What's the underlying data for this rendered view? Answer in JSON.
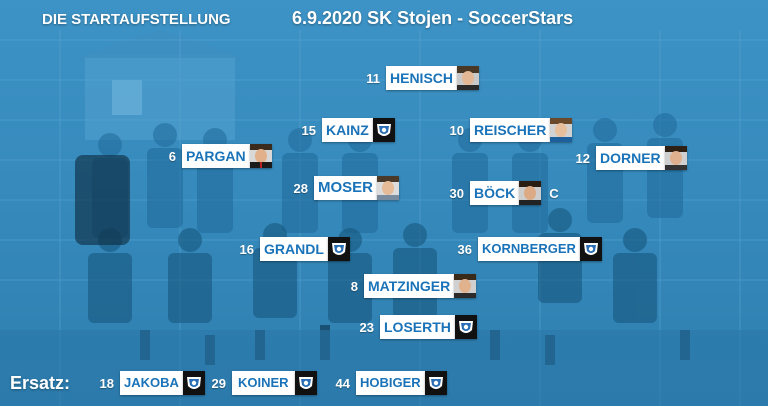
{
  "header": {
    "left": "DIE STARTAUFSTELLUNG",
    "right": "6.9.2020 SK Stojen - SoccerStars"
  },
  "players": [
    {
      "number": "11",
      "name": "HENISCH",
      "pic": "player-photo"
    },
    {
      "number": "15",
      "name": "KAINZ",
      "pic": "club-crest"
    },
    {
      "number": "10",
      "name": "REISCHER",
      "pic": "player-photo"
    },
    {
      "number": "6",
      "name": "PARGAN",
      "pic": "player-photo"
    },
    {
      "number": "12",
      "name": "DORNER",
      "pic": "player-photo"
    },
    {
      "number": "28",
      "name": "MOSER",
      "pic": "player-photo"
    },
    {
      "number": "30",
      "name": "BÖCK",
      "pic": "player-photo",
      "captain": "C"
    },
    {
      "number": "16",
      "name": "GRANDL",
      "pic": "club-crest"
    },
    {
      "number": "36",
      "name": "KORNBERGER",
      "pic": "club-crest"
    },
    {
      "number": "8",
      "name": "MATZINGER",
      "pic": "player-photo"
    },
    {
      "number": "23",
      "name": "LOSERTH",
      "pic": "club-crest"
    }
  ],
  "substitutes": {
    "label": "Ersatz:",
    "players": [
      {
        "number": "18",
        "name": "JAKOBA",
        "pic": "club-crest"
      },
      {
        "number": "29",
        "name": "KOINER",
        "pic": "club-crest"
      },
      {
        "number": "44",
        "name": "HOBIGER",
        "pic": "club-crest"
      }
    ]
  },
  "colors": {
    "background": "#2e7fb0",
    "name_text": "#1a73b8",
    "chip_bg": "#ffffff"
  }
}
